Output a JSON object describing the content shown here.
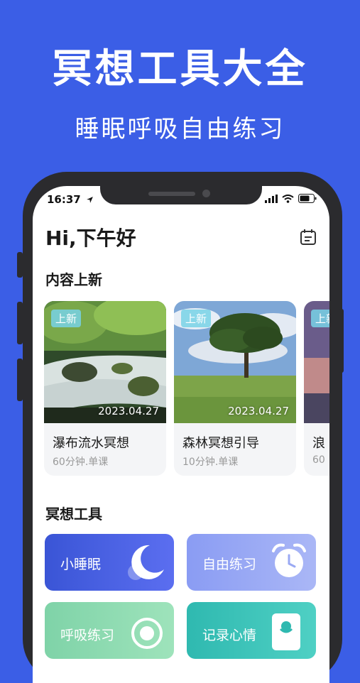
{
  "promo": {
    "title": "冥想工具大全",
    "subtitle": "睡眠呼吸自由练习"
  },
  "status_bar": {
    "time": "16:37"
  },
  "header": {
    "greeting": "Hi,下午好"
  },
  "new_content": {
    "section_title": "内容上新",
    "cards": [
      {
        "badge": "上新",
        "date": "2023.04.27",
        "title": "瀑布流水冥想",
        "meta": "60分钟.单课"
      },
      {
        "badge": "上新",
        "date": "2023.04.27",
        "title": "森林冥想引导",
        "meta": "10分钟.单课"
      },
      {
        "badge": "上新",
        "title": "浪",
        "meta": "60"
      }
    ]
  },
  "tools": {
    "section_title": "冥想工具",
    "items": [
      {
        "label": "小睡眠",
        "icon": "moon-icon"
      },
      {
        "label": "自由练习",
        "icon": "alarm-clock-icon"
      },
      {
        "label": "呼吸练习",
        "icon": "breath-icon"
      },
      {
        "label": "记录心情",
        "icon": "journal-icon"
      }
    ]
  }
}
